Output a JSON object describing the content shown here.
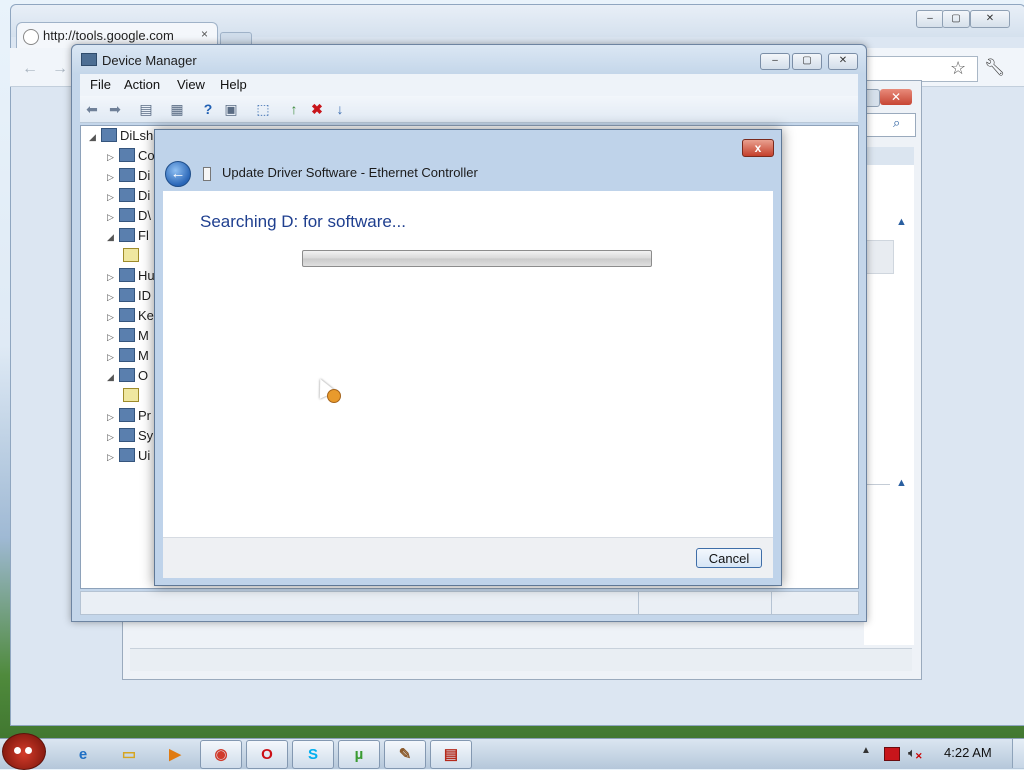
{
  "chrome": {
    "tab_title": "http://tools.google.com",
    "tab_close": "×",
    "win_controls": [
      "–",
      "▢",
      "✕"
    ]
  },
  "device_manager": {
    "title": "Device Manager",
    "menu": [
      "File",
      "Action",
      "View",
      "Help"
    ],
    "window_controls": [
      "–",
      "▢",
      "✕"
    ],
    "tree_root": "DiLsh",
    "tree_items": [
      {
        "label": "Co",
        "expander": "▷"
      },
      {
        "label": "Di",
        "expander": "▷"
      },
      {
        "label": "Di",
        "expander": "▷"
      },
      {
        "label": "D\\",
        "expander": "▷"
      },
      {
        "label": "Fl",
        "expander": "◢"
      },
      {
        "label": "",
        "expander": ""
      },
      {
        "label": "Hu",
        "expander": "▷"
      },
      {
        "label": "ID",
        "expander": "▷"
      },
      {
        "label": "Ke",
        "expander": "▷"
      },
      {
        "label": "M",
        "expander": "▷"
      },
      {
        "label": "M",
        "expander": "▷"
      },
      {
        "label": "O",
        "expander": "◢"
      },
      {
        "label": "",
        "expander": ""
      },
      {
        "label": "Pr",
        "expander": "▷"
      },
      {
        "label": "Sy",
        "expander": "▷"
      },
      {
        "label": "Ui",
        "expander": "▷"
      }
    ]
  },
  "dialog": {
    "title": "Update Driver Software - Ethernet Controller",
    "heading": "Searching D: for software...",
    "cancel_label": "Cancel",
    "close_label": "x",
    "progress": 0
  },
  "taskbar": {
    "clock": "4:22 AM",
    "apps": [
      {
        "name": "internet-explorer",
        "glyph": "e",
        "color": "#1f6fc4"
      },
      {
        "name": "windows-explorer",
        "glyph": "▭",
        "color": "#d6a520"
      },
      {
        "name": "media-player",
        "glyph": "▶",
        "color": "#e07b12"
      },
      {
        "name": "chrome",
        "glyph": "◉",
        "color": "#d13b2c"
      },
      {
        "name": "opera",
        "glyph": "O",
        "color": "#cc0f16"
      },
      {
        "name": "skype",
        "glyph": "S",
        "color": "#00aff0"
      },
      {
        "name": "utorrent",
        "glyph": "µ",
        "color": "#3a9b32"
      },
      {
        "name": "paint-tool",
        "glyph": "✎",
        "color": "#8b5a2b"
      },
      {
        "name": "device-manager",
        "glyph": "▤",
        "color": "#b52a1c"
      }
    ]
  }
}
